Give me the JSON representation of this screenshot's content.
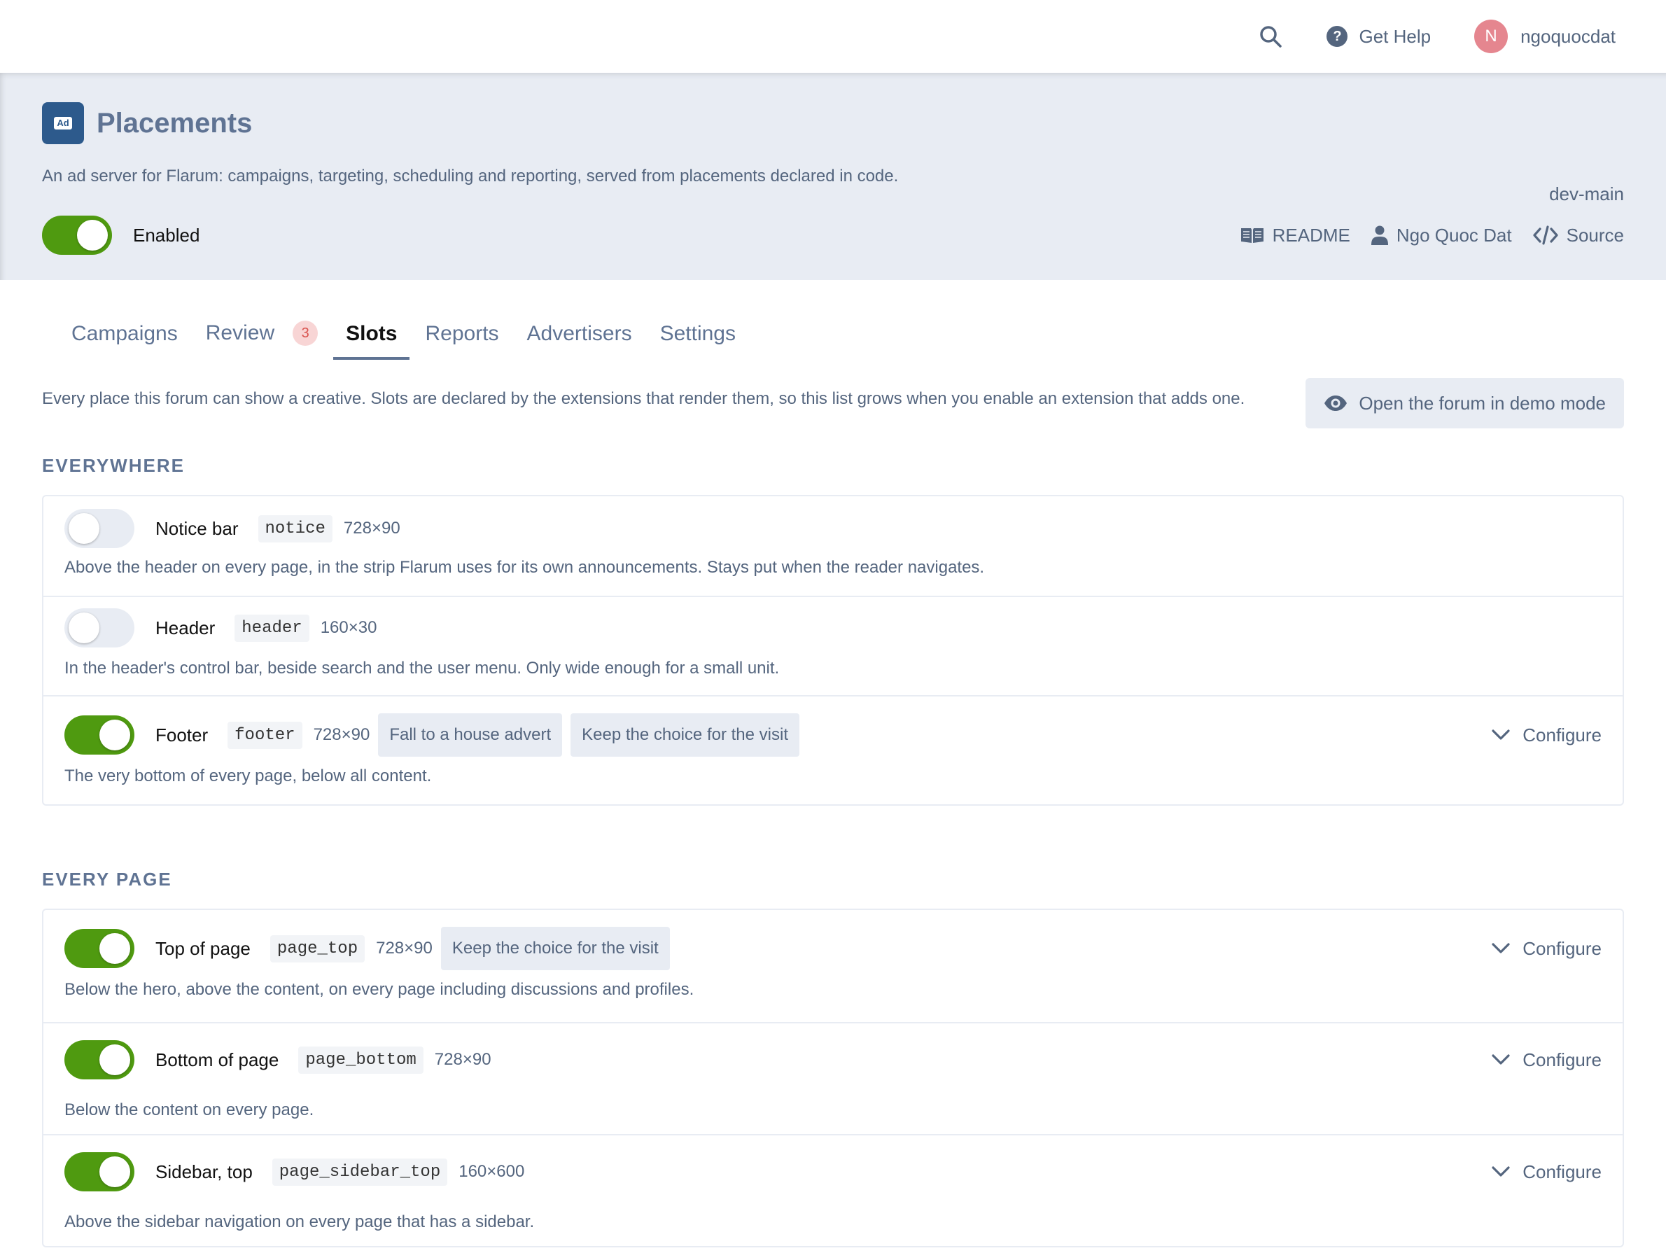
{
  "topbar": {
    "help_label": "Get Help",
    "avatar_initial": "N",
    "username": "ngoquocdat"
  },
  "hero": {
    "icon_text": "Ad",
    "title": "Placements",
    "version": "dev-main",
    "description": "An ad server for Flarum: campaigns, targeting, scheduling and reporting, served from placements declared in code.",
    "enabled_label": "Enabled",
    "enabled": true,
    "links": {
      "readme": "README",
      "author": "Ngo Quoc Dat",
      "source": "Source"
    }
  },
  "tabs": [
    {
      "label": "Campaigns"
    },
    {
      "label": "Review",
      "badge": "3"
    },
    {
      "label": "Slots"
    },
    {
      "label": "Reports"
    },
    {
      "label": "Advertisers"
    },
    {
      "label": "Settings"
    }
  ],
  "active_tab": "Slots",
  "intro": {
    "text": "Every place this forum can show a creative. Slots are declared by the extensions that render them, so this list grows when you enable an extension that adds one.",
    "demo_button": "Open the forum in demo mode"
  },
  "configure_label": "Configure",
  "sections": [
    {
      "heading": "EVERYWHERE",
      "slots": [
        {
          "name": "Notice bar",
          "code": "notice",
          "size": "728×90",
          "enabled": false,
          "chips": [],
          "description": "Above the header on every page, in the strip Flarum uses for its own announcements. Stays put when the reader navigates."
        },
        {
          "name": "Header",
          "code": "header",
          "size": "160×30",
          "enabled": false,
          "chips": [],
          "description": "In the header's control bar, beside search and the user menu. Only wide enough for a small unit."
        },
        {
          "name": "Footer",
          "code": "footer",
          "size": "728×90",
          "enabled": true,
          "chips": [
            "Fall to a house advert",
            "Keep the choice for the visit"
          ],
          "description": "The very bottom of every page, below all content."
        }
      ]
    },
    {
      "heading": "EVERY PAGE",
      "slots": [
        {
          "name": "Top of page",
          "code": "page_top",
          "size": "728×90",
          "enabled": true,
          "chips": [
            "Keep the choice for the visit"
          ],
          "description": "Below the hero, above the content, on every page including discussions and profiles."
        },
        {
          "name": "Bottom of page",
          "code": "page_bottom",
          "size": "728×90",
          "enabled": true,
          "chips": [],
          "description": "Below the content on every page."
        },
        {
          "name": "Sidebar, top",
          "code": "page_sidebar_top",
          "size": "160×600",
          "enabled": true,
          "chips": [],
          "description": "Above the sidebar navigation on every page that has a sidebar."
        }
      ]
    }
  ],
  "colors": {
    "accent": "#4f9a10",
    "muted_text": "#54657e",
    "hero_bg": "#e8ecf3",
    "badge_bg": "#f8d5d5",
    "badge_text": "#d9534f",
    "extension_icon": "#2d5a8c"
  }
}
